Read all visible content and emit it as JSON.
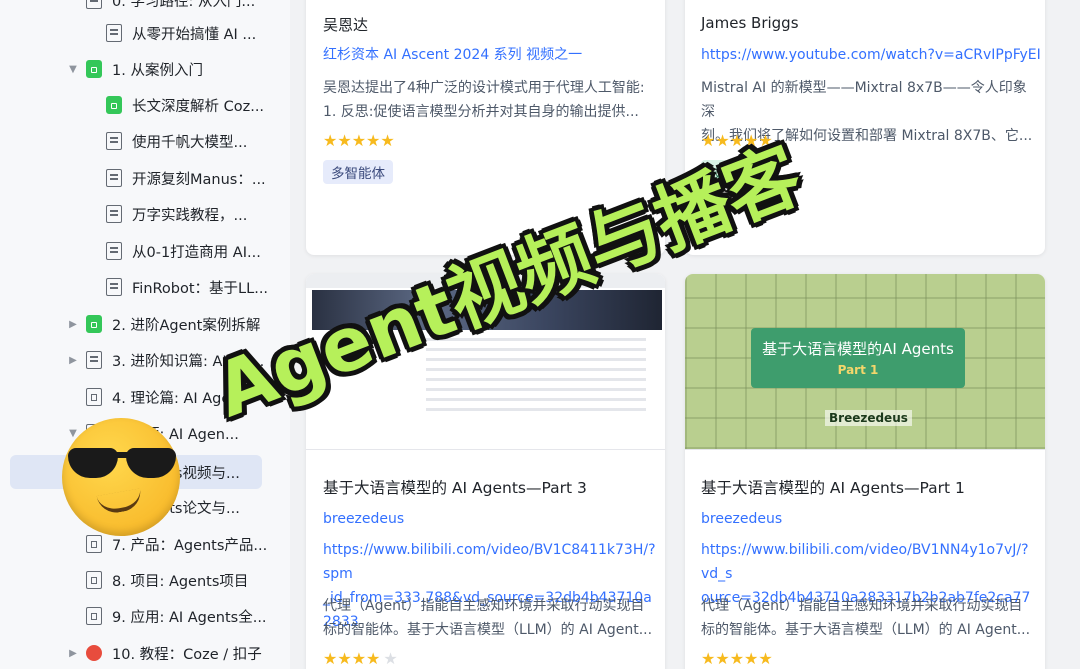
{
  "sidebar": {
    "items": [
      {
        "label": "0. 学习路径: 从入门...",
        "caret": "",
        "icon": "doc"
      },
      {
        "label": "从零开始搞懂 AI ...",
        "caret": "",
        "icon": "doc"
      },
      {
        "label": "1. 从案例入门",
        "caret": "▼",
        "icon": "green"
      },
      {
        "label": "长文深度解析 Coz...",
        "caret": "",
        "icon": "green"
      },
      {
        "label": "使用千帆大模型...",
        "caret": "",
        "icon": "doc"
      },
      {
        "label": "开源复刻Manus：...",
        "caret": "",
        "icon": "doc"
      },
      {
        "label": "万字实践教程，...",
        "caret": "",
        "icon": "doc"
      },
      {
        "label": "从0-1打造商用 AI...",
        "caret": "",
        "icon": "doc"
      },
      {
        "label": "FinRobot：基于LL...",
        "caret": "",
        "icon": "doc"
      },
      {
        "label": "2. 进阶Agent案例拆解",
        "caret": "▶",
        "icon": "green"
      },
      {
        "label": "3. 进阶知识篇: AI Ag...",
        "caret": "▶",
        "icon": "doc"
      },
      {
        "label": "4. 理论篇: AI Agen...",
        "caret": "",
        "icon": "square"
      },
      {
        "label": "5. 资源: AI Agen...",
        "caret": "▼",
        "icon": "square"
      },
      {
        "label": "Agents视频与...",
        "caret": "",
        "icon": "doc"
      },
      {
        "label": "Agents论文与...",
        "caret": "",
        "icon": "doc"
      },
      {
        "label": "7. 产品：Agents产品...",
        "caret": "",
        "icon": "square"
      },
      {
        "label": "8. 项目: Agents项目",
        "caret": "",
        "icon": "square"
      },
      {
        "label": "9. 应用: AI Agents全...",
        "caret": "",
        "icon": "square"
      },
      {
        "label": "10. 教程：Coze / 扣子",
        "caret": "▶",
        "icon": "red"
      }
    ]
  },
  "cards": [
    {
      "author": "吴恩达",
      "link": "红杉资本 AI Ascent 2024 系列 视频之一",
      "desc_l1": "吴恩达提出了4种广泛的设计模式用于代理人工智能:",
      "desc_l2": "1. 反思:促使语言模型分析并对其自身的输出提供...",
      "stars": "★★★★★",
      "tag": "多智能体"
    },
    {
      "author": "James Briggs",
      "link": "https://www.youtube.com/watch?v=aCRvIPpFyEI",
      "desc_l1": "Mistral AI 的新模型——Mixtral 8x7B——令人印象深",
      "desc_l2": "刻。我们将了解如何设置和部署 Mixtral 8X7B、它...",
      "stars": "★★★★★",
      "tag": "技术教程"
    },
    {
      "title": "基于大语言模型的 AI Agents—Part 3",
      "author": "breezedeus",
      "link_l1": "https://www.bilibili.com/video/BV1C8411k73H/?spm",
      "link_l2": "_id_from=333.788&vd_source=32db4b43710a2833",
      "desc_l1": "代理（Agent）指能自主感知环境并采取行动实现目",
      "desc_l2": "标的智能体。基于大语言模型（LLM）的 AI Agent...",
      "stars_on": "★★★★",
      "stars_off": "★"
    },
    {
      "title": "基于大语言模型的 AI Agents—Part 1",
      "author": "breezedeus",
      "link_l1": "https://www.bilibili.com/video/BV1NN4y1o7vJ/?vd_s",
      "link_l2": "ource=32db4b43710a283317b2b2ab7fe2ca77",
      "desc_l1": "代理（Agent）指能自主感知环境并采取行动实现目",
      "desc_l2": "标的智能体。基于大语言模型（LLM）的 AI Agent...",
      "stars": "★★★★★",
      "thumb_title": "基于大语言模型的AI Agents",
      "thumb_part": "Part 1",
      "thumb_author": "Breezedeus"
    }
  ],
  "overlay": {
    "text": "Agent视频与播客",
    "color": "#b6f05a"
  },
  "colors": {
    "link": "#3370ff",
    "star": "#f7ba1e",
    "active_bg": "#dfe6f5"
  }
}
